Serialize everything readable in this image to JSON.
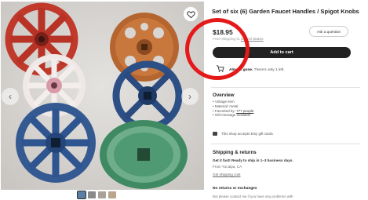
{
  "listing": {
    "title": "Set of six (6) Garden Faucet Handles / Spigot Knobs",
    "price": "$18.95",
    "ask_question_label": "Ask a question",
    "shipping_prefix": "Free shipping to",
    "shipping_destination": "United States",
    "add_to_cart_label": "Add to cart",
    "stock_bold": "Almost gone.",
    "stock_text": "There's only 1 left."
  },
  "overview": {
    "heading": "Overview",
    "items": [
      "Vintage item",
      "Material: metal",
      "Gift message available"
    ],
    "favorited_prefix": "Favorited by:",
    "favorited_count": "777 people",
    "gift_card_text": "This shop accepts Etsy gift cards"
  },
  "shipping": {
    "heading": "Shipping & returns",
    "fast_text": "Get it fast! Ready to ship in 1–3 business days.",
    "from_text": "From Yucaipa, CA",
    "cost_link": "Get shipping cost"
  },
  "returns": {
    "heading": "No returns or exchanges",
    "text": "But please contact me if you have any problems with"
  },
  "gallery": {
    "thumbnail_count": 4,
    "photo_alt": "Six vintage garden faucet handles in red, orange, white, blue, blue and green"
  },
  "icons": {
    "favorite": "heart-icon",
    "prev": "chevron-left-icon",
    "next": "chevron-right-icon",
    "stock": "cart-icon",
    "gift": "gift-card-icon"
  },
  "colors": {
    "button_dark": "#222222",
    "annotation": "#e41a1a",
    "handle_red": "#c0392b",
    "handle_orange": "#b5652f",
    "handle_blue": "#2c4f86",
    "handle_green": "#3f8a63"
  }
}
